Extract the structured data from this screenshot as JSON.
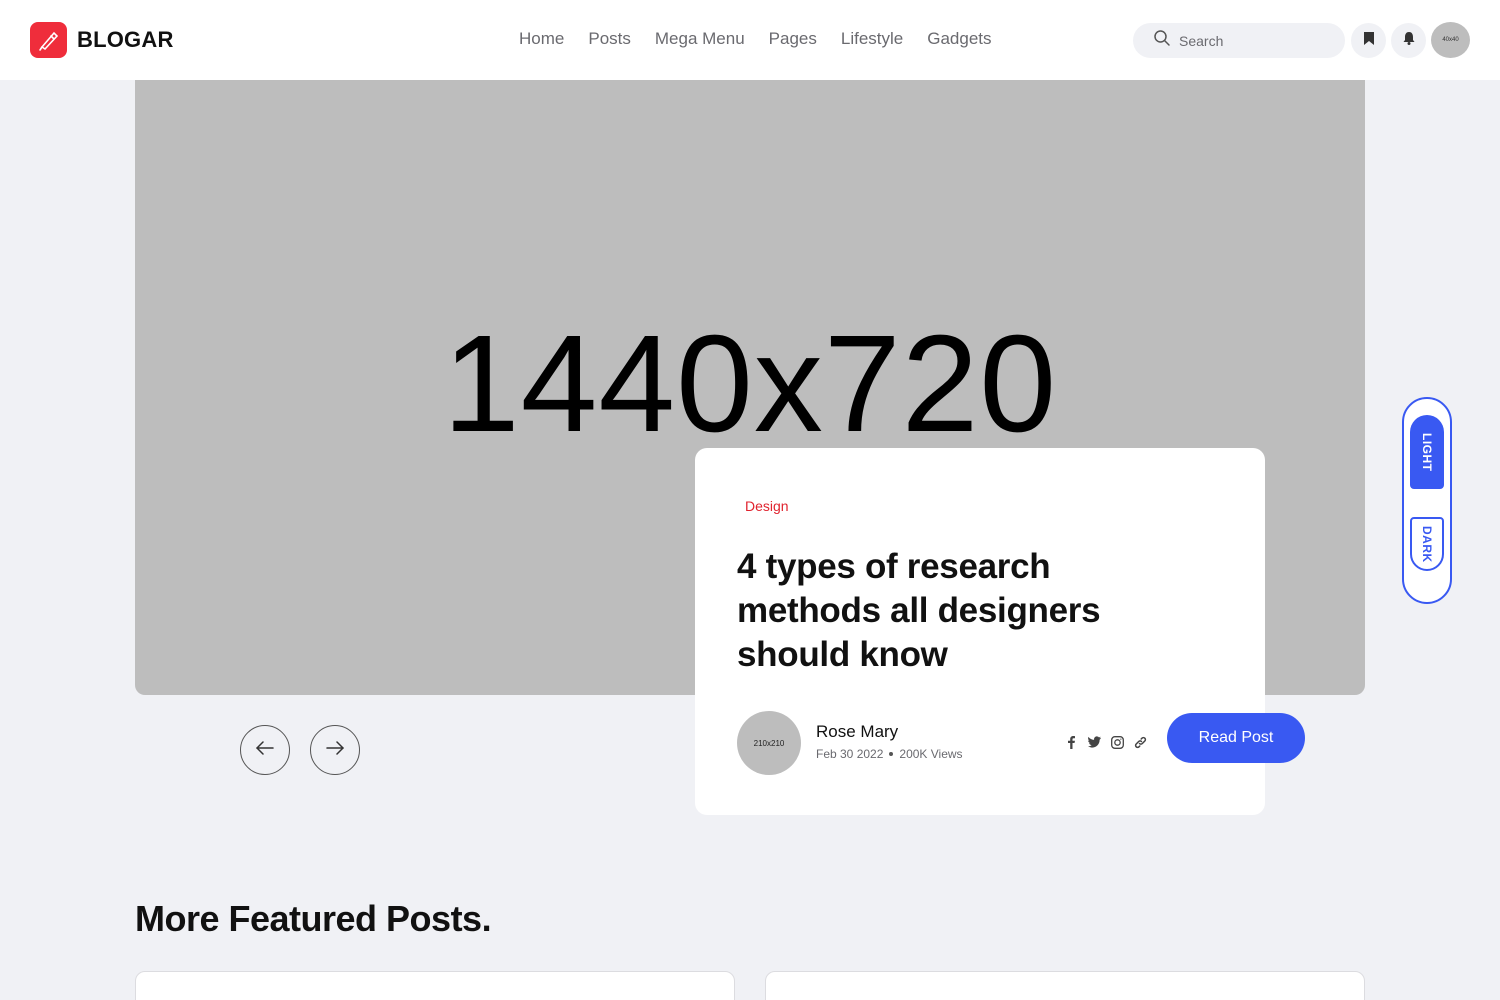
{
  "brand": {
    "name": "BLOGAR",
    "accent": "#ef2d3b"
  },
  "nav": [
    {
      "label": "Home"
    },
    {
      "label": "Posts"
    },
    {
      "label": "Mega Menu"
    },
    {
      "label": "Pages"
    },
    {
      "label": "Lifestyle"
    },
    {
      "label": "Gadgets"
    }
  ],
  "search": {
    "placeholder": "Search",
    "icon": "search-icon"
  },
  "header_actions": {
    "bookmark_icon": "bookmark-icon",
    "bell_icon": "bell-icon",
    "avatar_text": "40x40"
  },
  "hero": {
    "image_label": "1440x720",
    "category": "Design",
    "title": "4 types of research methods all designers should know",
    "author": {
      "avatar_text": "210x210",
      "name": "Rose Mary",
      "date": "Feb 30 2022",
      "views": "200K Views"
    },
    "read_button": "Read Post",
    "social_icons": [
      "facebook-icon",
      "twitter-icon",
      "instagram-icon",
      "link-icon"
    ]
  },
  "mode_toggle": {
    "light": "LIGHT",
    "dark": "DARK",
    "color": "#3959f2"
  },
  "featured": {
    "title": "More Featured Posts."
  }
}
